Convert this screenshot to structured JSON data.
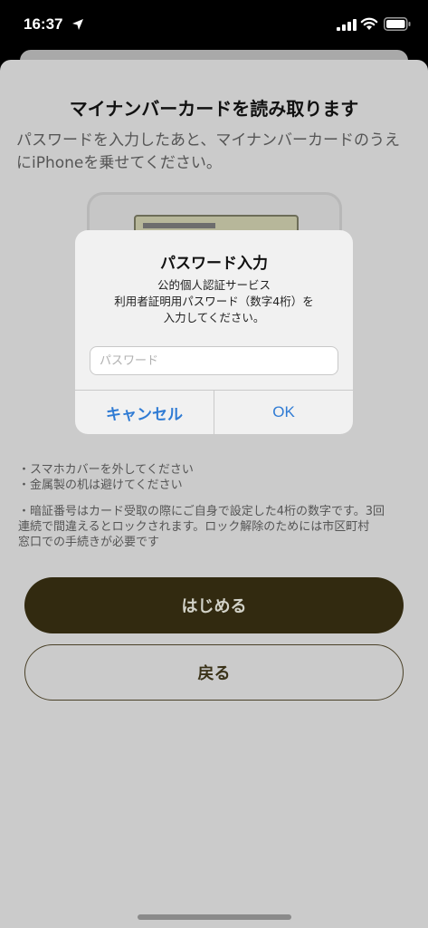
{
  "status": {
    "time": "16:37",
    "icons": [
      "location-arrow-icon",
      "cellular-signal-icon",
      "wifi-icon",
      "battery-icon"
    ]
  },
  "sheet": {
    "title": "マイナンバーカードを読み取ります",
    "description": "パスワードを入力したあと、マイナンバーカードのうえにiPhoneを乗せてください。",
    "notes": [
      "・スマホカバーを外してください",
      "・金属製の机は避けてください"
    ],
    "warning_lines": [
      "・暗証番号はカード受取の際にご自身で設定した4桁の数字です。3回",
      "  連続で間違えるとロックされます。ロック解除のためには市区町村",
      "  窓口での手続きが必要です"
    ],
    "primary_label": "はじめる",
    "secondary_label": "戻る"
  },
  "dialog": {
    "title": "パスワード入力",
    "message_lines": [
      "公的個人認証サービス",
      "利用者証明用パスワード（数字4桁）を",
      "入力してください。"
    ],
    "input_placeholder": "パスワード",
    "input_value": "",
    "cancel_label": "キャンセル",
    "ok_label": "OK"
  },
  "colors": {
    "accent_blue": "#2f7bd4",
    "primary_button": "#322a10",
    "sheet_background": "#cbcbcb"
  }
}
